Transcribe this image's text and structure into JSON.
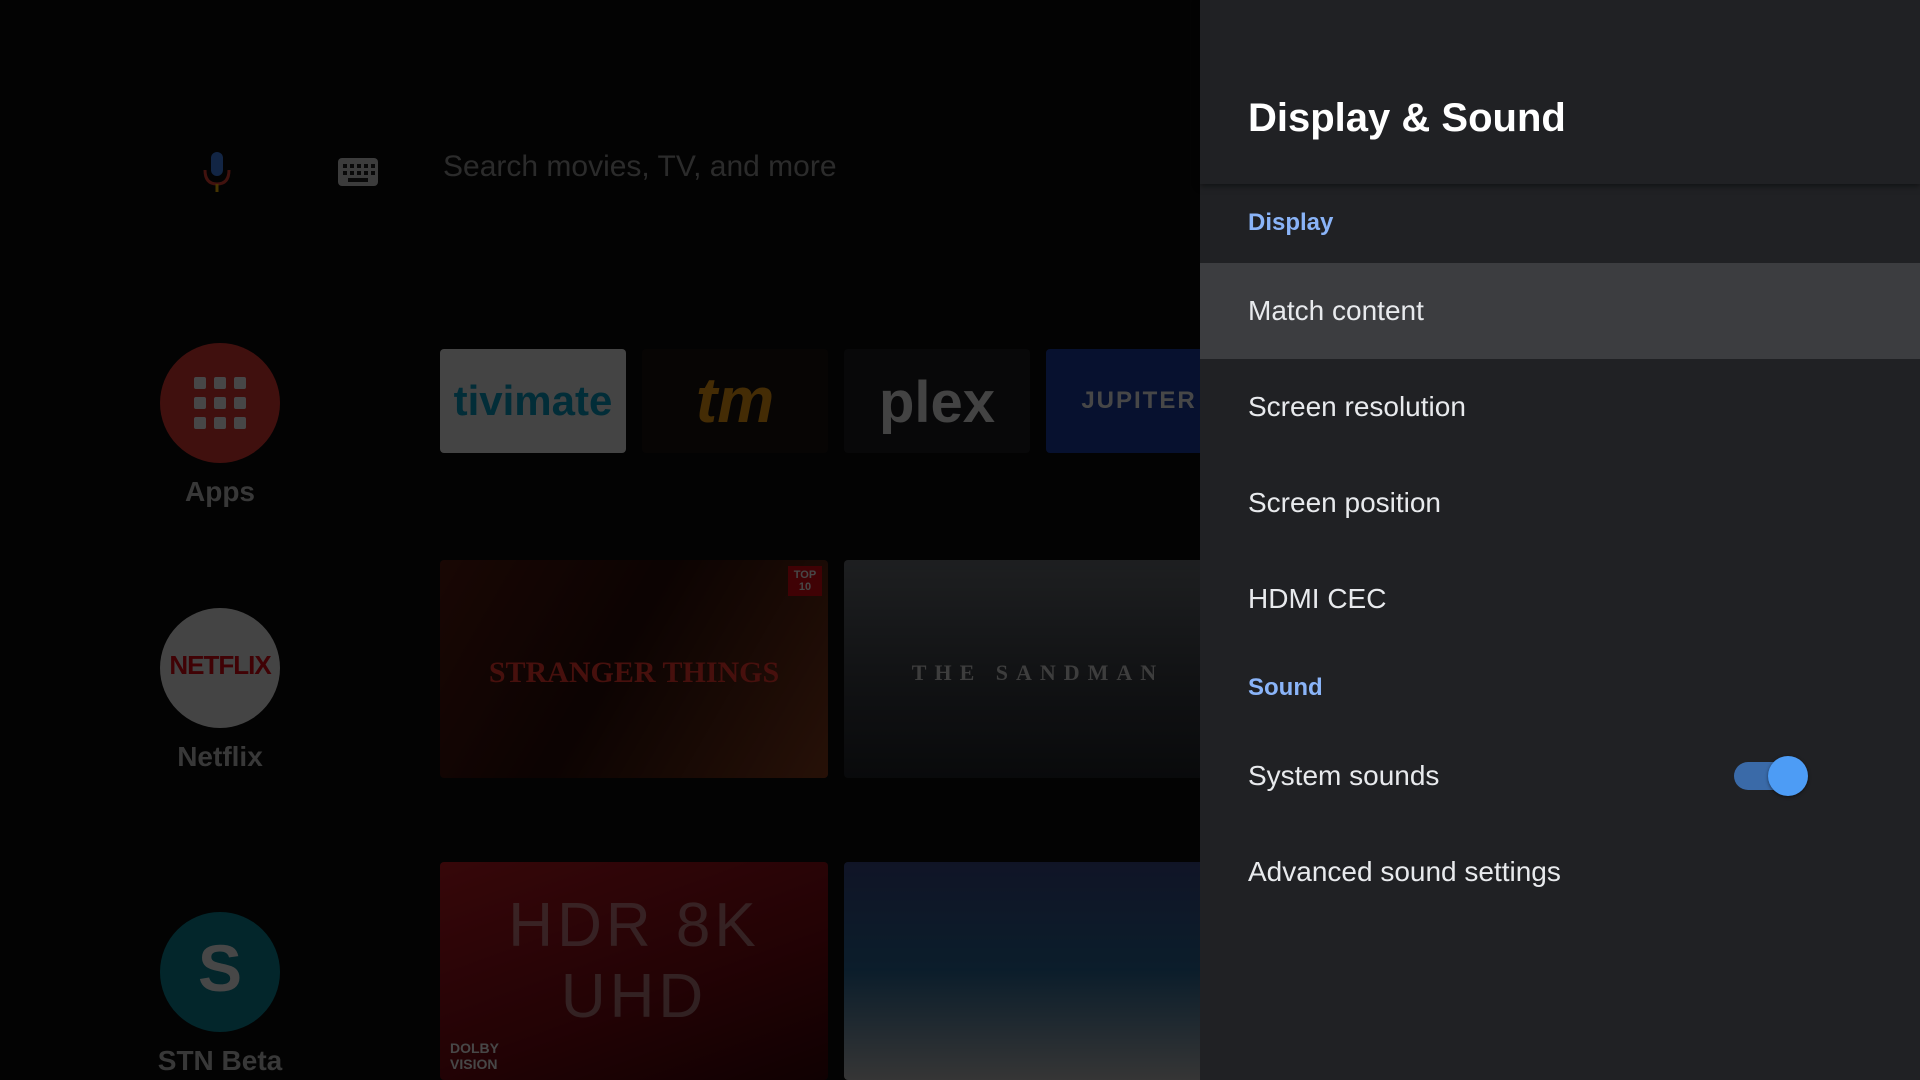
{
  "search": {
    "placeholder": "Search movies, TV, and more"
  },
  "favorites": [
    {
      "label": "Apps",
      "icon": "apps-grid-icon",
      "color": "#e53935"
    },
    {
      "label": "Netflix",
      "icon": "netflix-logo",
      "logo_text": "NETFLIX",
      "color": "#e50914"
    },
    {
      "label": "STN Beta",
      "icon": "stn-logo",
      "logo_text": "S",
      "color": "#0b8a9c"
    }
  ],
  "app_tiles": [
    {
      "name": "tivimate",
      "logo_text": "tivimate"
    },
    {
      "name": "tm",
      "logo_text": "tm"
    },
    {
      "name": "plex",
      "logo_text": "plex"
    },
    {
      "name": "jupiter",
      "logo_text": "JUPITER"
    }
  ],
  "content_tiles": [
    {
      "title": "STRANGER THINGS",
      "badge": "TOP 10"
    },
    {
      "title": "THE SANDMAN"
    },
    {
      "title": "HDR 8K UHD",
      "brand": "DOLBY VISION"
    },
    {
      "title": ""
    }
  ],
  "panel": {
    "title": "Display & Sound",
    "sections": [
      {
        "label": "Display"
      },
      {
        "label": "Sound"
      }
    ],
    "items": [
      {
        "label": "Match content",
        "focused": true
      },
      {
        "label": "Screen resolution"
      },
      {
        "label": "Screen position"
      },
      {
        "label": "HDMI CEC"
      },
      {
        "label": "System sounds",
        "toggle": "on"
      },
      {
        "label": "Advanced sound settings"
      }
    ]
  },
  "colors": {
    "accent": "#8ab4f8",
    "panel_bg": "#202124",
    "focus_bg": "#3c3d40",
    "toggle": "#4d9cf5"
  }
}
